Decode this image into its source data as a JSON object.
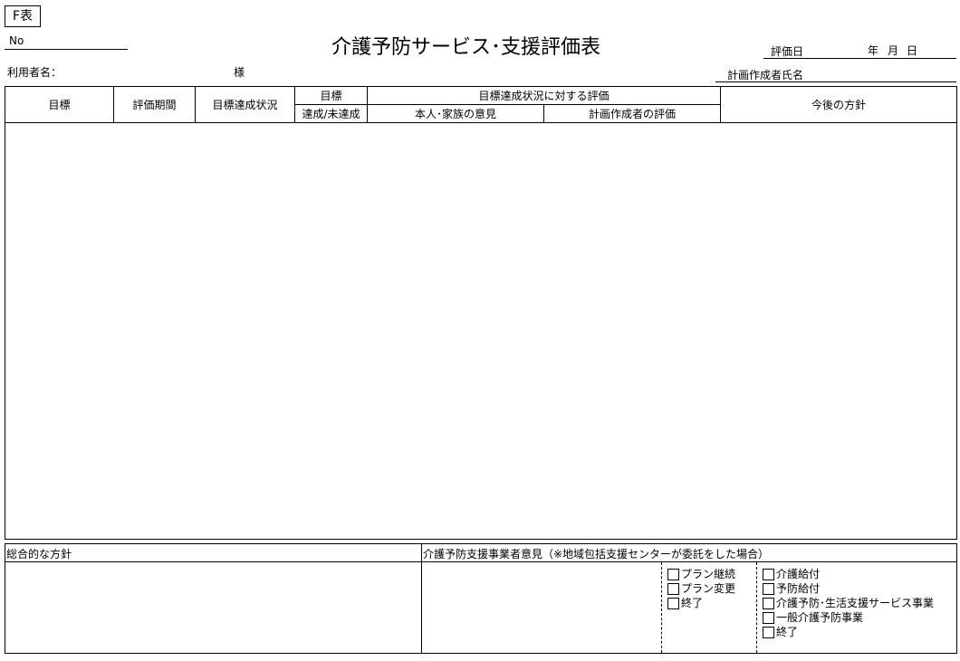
{
  "form_code": "F表",
  "header": {
    "no_label": "No",
    "user_label": "利用者名：",
    "honorific": "様",
    "title": "介護予防サービス･支援評価表",
    "eval_date_label": "評価日",
    "year": "年",
    "month": "月",
    "day": "日",
    "planner_label": "計画作成者氏名"
  },
  "table": {
    "goal": "目標",
    "period": "評価期間",
    "status": "目標達成状況",
    "achieve_top": "目標",
    "achieve_bottom": "達成/未達成",
    "eval_group": "目標達成状況に対する評価",
    "opinion_self": "本人･家族の意見",
    "opinion_planner": "計画作成者の評価",
    "future": "今後の方針"
  },
  "bottom": {
    "overall_label": "総合的な方針",
    "opinion_label": "介護予防支援事業者意見（※地域包括支援センターが委託をした場合）",
    "plan_options": [
      "プラン継続",
      "プラン変更",
      "終了"
    ],
    "service_options": [
      "介護給付",
      "予防給付",
      "介護予防･生活支援サービス事業",
      "一般介護予防事業",
      "終了"
    ]
  }
}
